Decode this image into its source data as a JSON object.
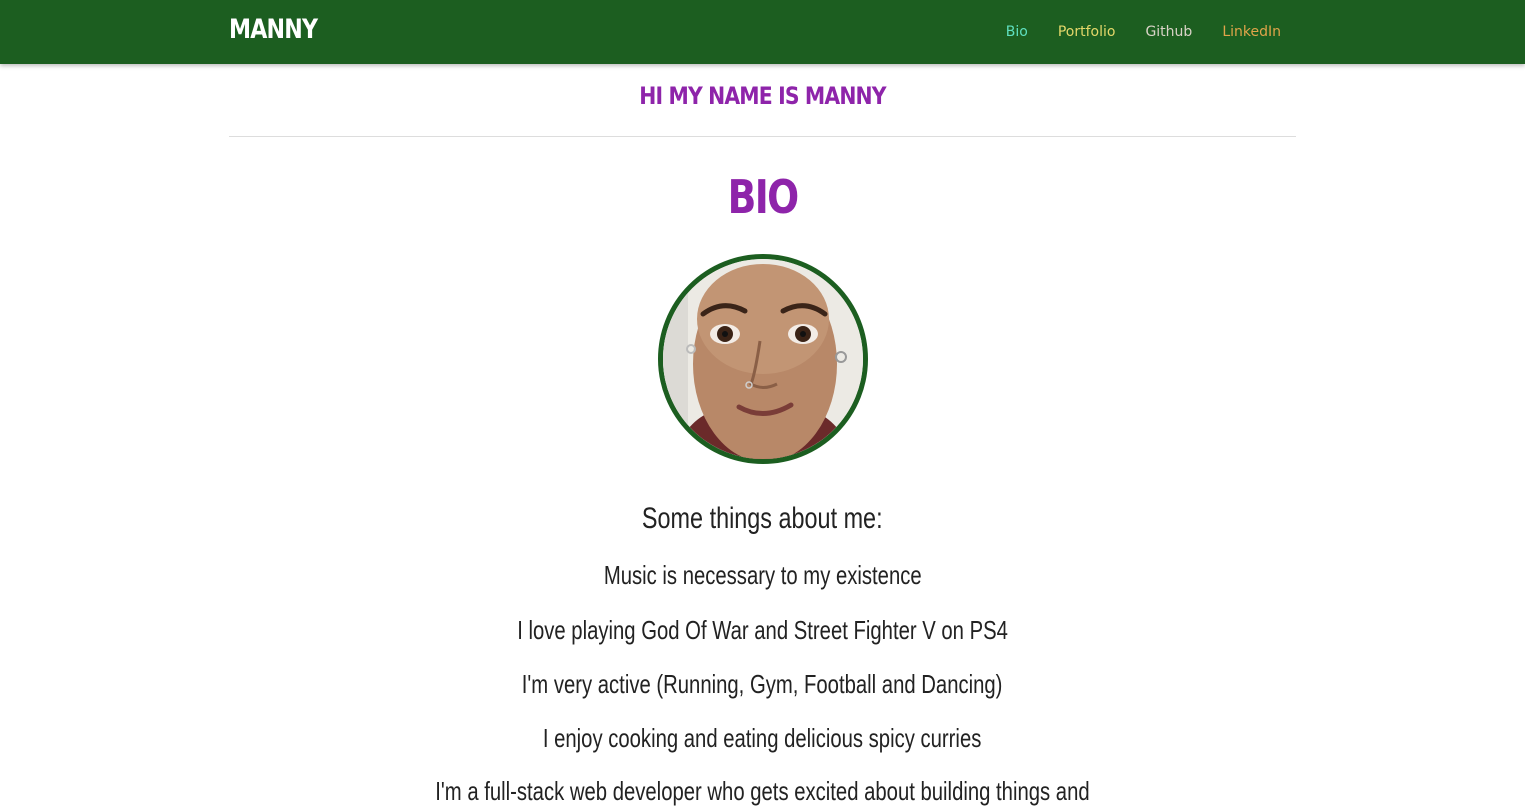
{
  "navbar": {
    "brand": "MANNY",
    "links": [
      {
        "label": "Bio",
        "color": "#5fe0c0"
      },
      {
        "label": "Portfolio",
        "color": "#e3d76a"
      },
      {
        "label": "Github",
        "color": "#d9d3c7"
      },
      {
        "label": "LinkedIn",
        "color": "#e0a44a"
      }
    ]
  },
  "header": {
    "greeting": "HI MY NAME IS MANNY"
  },
  "bio": {
    "title": "BIO",
    "avatar_icon": "profile-photo",
    "intro": "Some things about me:",
    "items": [
      "Music is necessary to my existence",
      "I love playing God Of War and Street Fighter V on PS4",
      "I'm very active (Running, Gym, Football and Dancing)",
      "I enjoy cooking and eating delicious spicy curries",
      "I'm a full-stack web developer who gets excited about building things and"
    ]
  },
  "colors": {
    "navbar_bg": "#1c5e20",
    "accent_purple": "#8e24aa",
    "avatar_border": "#1c5e20"
  }
}
